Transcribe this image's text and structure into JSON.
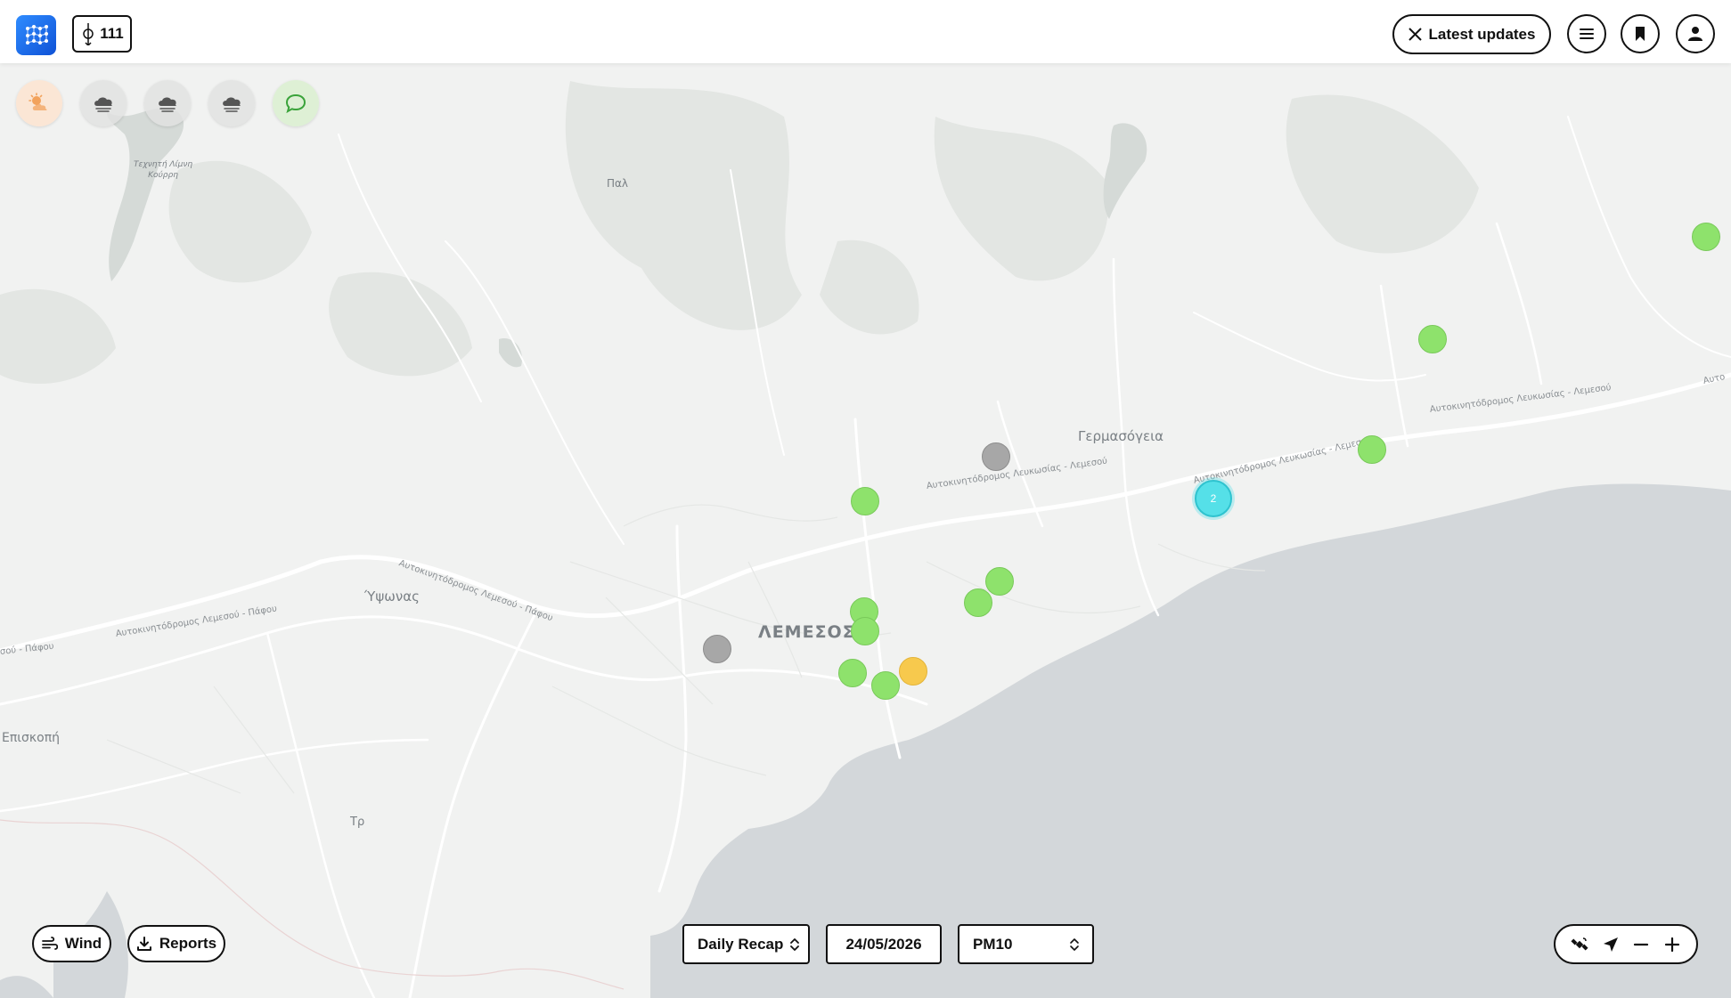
{
  "header": {
    "sensor_count": "111",
    "latest_updates_label": "Latest updates",
    "icons": [
      "app-logo",
      "sensor-icon",
      "x-logo-icon",
      "menu-icon",
      "bookmark-icon",
      "user-icon"
    ]
  },
  "weather_buttons": [
    "sun-cloud-icon",
    "rain-cloud-icon",
    "rain-cloud-icon",
    "rain-cloud-icon",
    "chat-bubble-icon"
  ],
  "map": {
    "places": {
      "lake_line1": "Τεχνητή Λίμνη",
      "lake_line2": "Κούρρη",
      "pa": "Παλ",
      "germasogeia": "Γερμασόγεια",
      "ypsonas": "Ύψωνας",
      "lemesos": "ΛΕΜΕΣΟΣ",
      "episkopi": "Επισκοπή",
      "tr": "Τρ"
    },
    "roads": {
      "r1": "Αυτοκινητόδρομος Λευκωσίας - Λεμεσού",
      "r2": "Αυτοκινητόδρομος Λευκωσίας - Λεμεσού",
      "r3": "Αυτοκινητόδρομος Λευκωσίας - Λεμεσού",
      "r4": "Αυτοκινητόδρομος Λεμεσού - Πάφου",
      "r5": "Αυτοκινητόδρομος Λεμεσού - Πάφου",
      "r6": "σού - Πάφου",
      "r7": "Αυτο"
    },
    "cluster_count": "2",
    "legend_colors": {
      "good": "#8ee26c",
      "no_data": "#a7a7a7",
      "moderate": "#f7c94d",
      "cluster": "#55e0e8",
      "sea": "#d3d7da"
    }
  },
  "bottom": {
    "wind_label": "Wind",
    "reports_label": "Reports",
    "recap_label": "Daily Recap",
    "date_value": "24/05/2026",
    "pollutant_value": "PM10",
    "controls": [
      "satellite-icon",
      "locate-icon",
      "zoom-out-icon",
      "zoom-in-icon"
    ]
  }
}
